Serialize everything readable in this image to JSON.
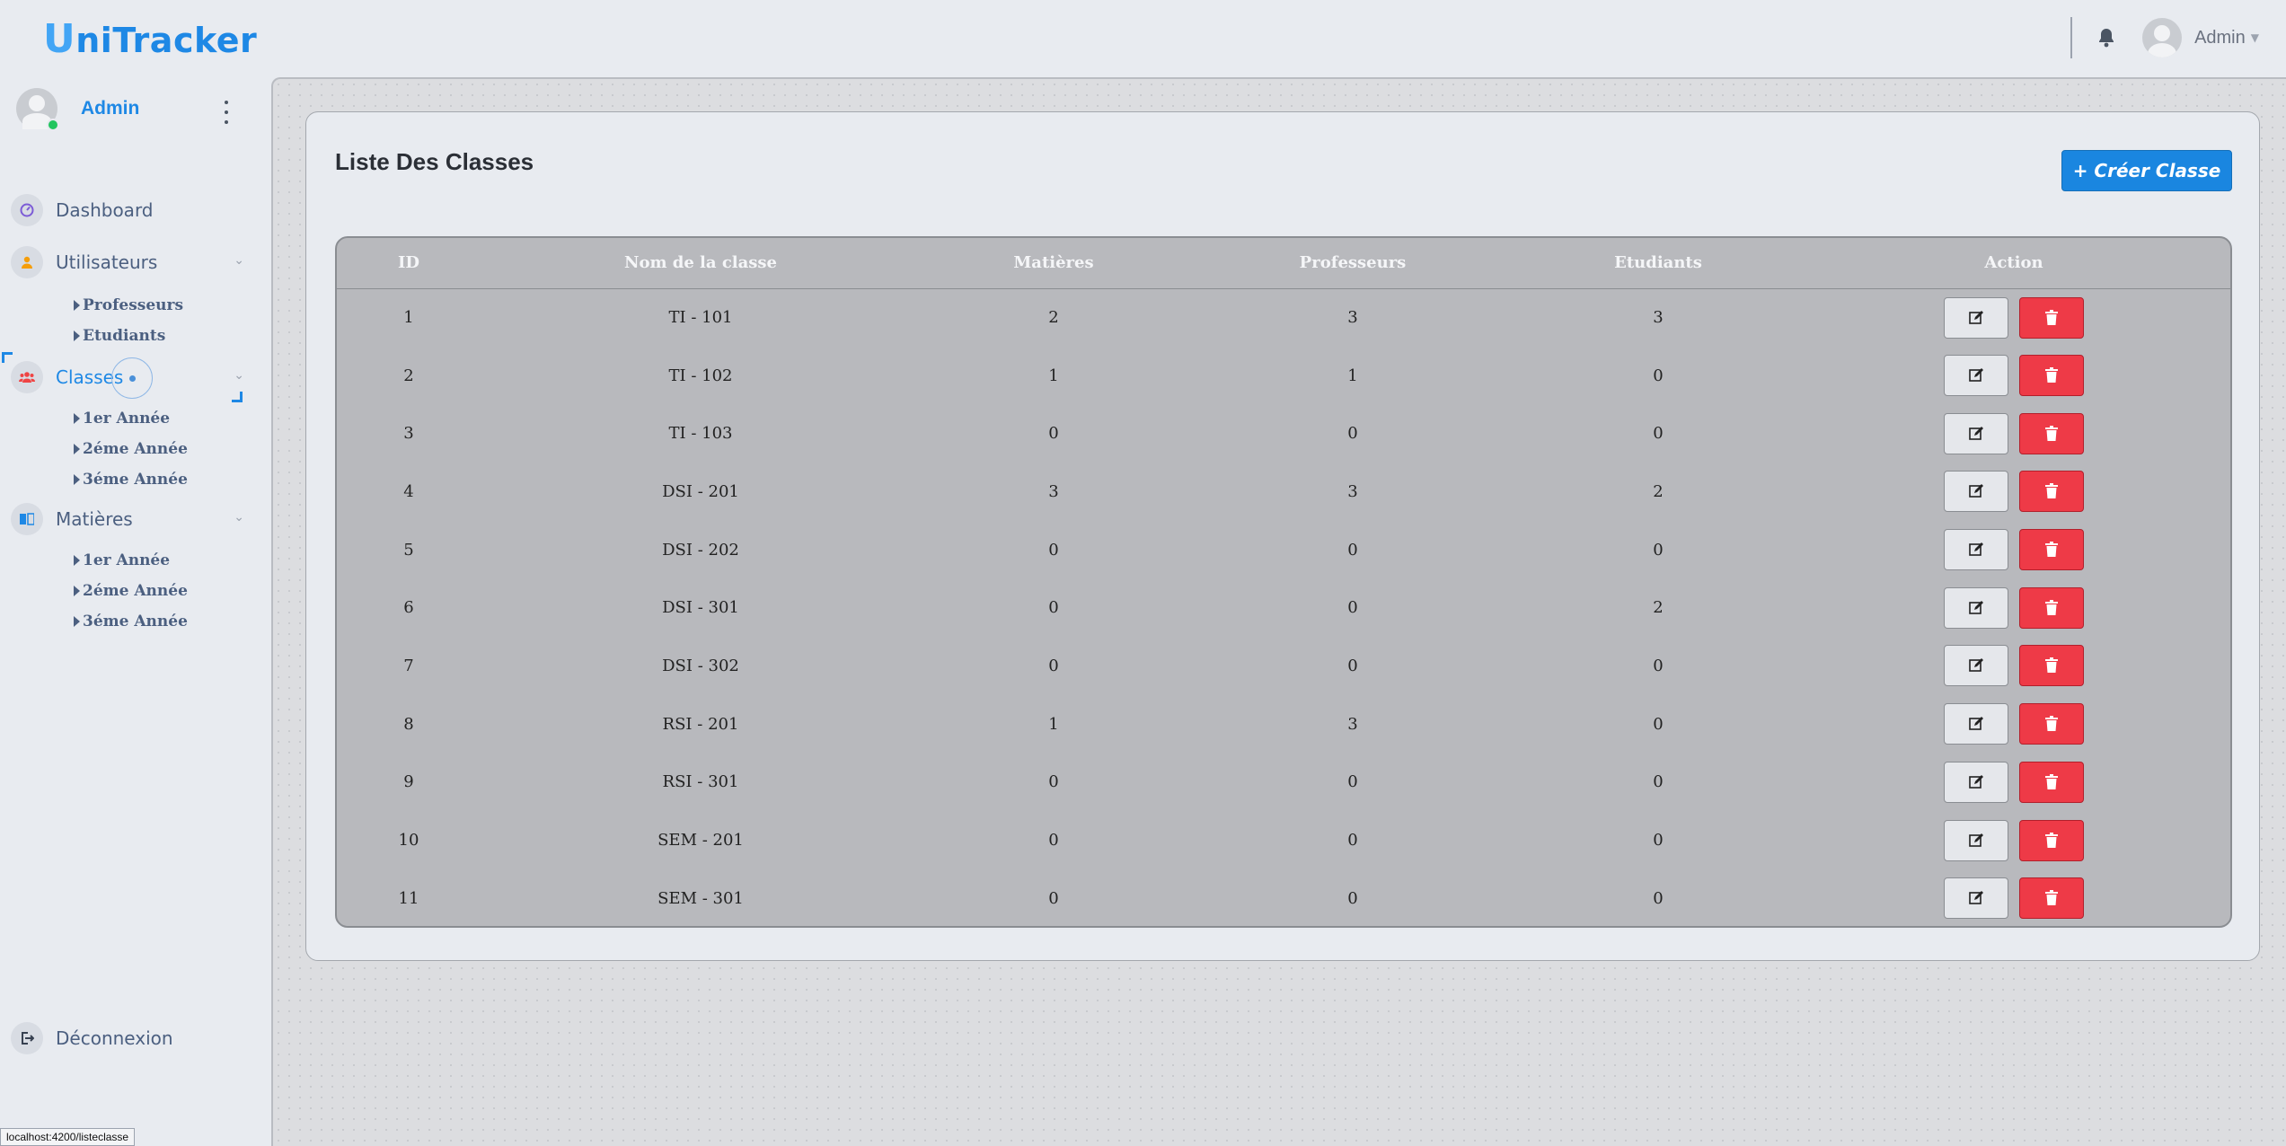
{
  "app": {
    "logo_first": "U",
    "logo_rest": "niTracker"
  },
  "topbar": {
    "user_label": "Admin"
  },
  "sidebar": {
    "user_name": "Admin",
    "items": [
      {
        "label": "Dashboard",
        "icon": "gauge-icon"
      },
      {
        "label": "Utilisateurs",
        "icon": "user-icon",
        "subitems": [
          "Professeurs",
          "Etudiants"
        ]
      },
      {
        "label": "Classes",
        "icon": "group-icon",
        "subitems": [
          "1er Année",
          "2éme Année",
          "3éme Année"
        ]
      },
      {
        "label": "Matières",
        "icon": "book-icon",
        "subitems": [
          "1er Année",
          "2éme Année",
          "3éme Année"
        ]
      }
    ],
    "logout_label": "Déconnexion"
  },
  "status_bar_url": "localhost:4200/listeclasse",
  "page": {
    "title": "Liste Des Classes",
    "create_button": "+ Créer Classe"
  },
  "table": {
    "headers": [
      "ID",
      "Nom de la classe",
      "Matières",
      "Professeurs",
      "Etudiants",
      "Action"
    ],
    "rows": [
      [
        "1",
        "TI - 101",
        "2",
        "3",
        "3"
      ],
      [
        "2",
        "TI - 102",
        "1",
        "1",
        "0"
      ],
      [
        "3",
        "TI - 103",
        "0",
        "0",
        "0"
      ],
      [
        "4",
        "DSI - 201",
        "3",
        "3",
        "2"
      ],
      [
        "5",
        "DSI - 202",
        "0",
        "0",
        "0"
      ],
      [
        "6",
        "DSI - 301",
        "0",
        "0",
        "2"
      ],
      [
        "7",
        "DSI - 302",
        "0",
        "0",
        "0"
      ],
      [
        "8",
        "RSI - 201",
        "1",
        "3",
        "0"
      ],
      [
        "9",
        "RSI - 301",
        "0",
        "0",
        "0"
      ],
      [
        "10",
        "SEM - 201",
        "0",
        "0",
        "0"
      ],
      [
        "11",
        "SEM - 301",
        "0",
        "0",
        "0"
      ]
    ]
  },
  "colors": {
    "accent": "#1e88e5",
    "danger": "#ee3a47",
    "online": "#22c55e"
  }
}
